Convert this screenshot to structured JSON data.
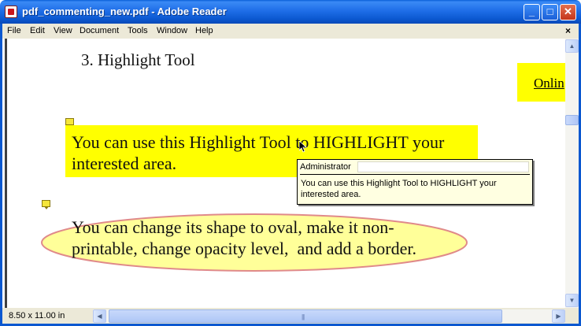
{
  "window": {
    "title": "pdf_commenting_new.pdf - Adobe Reader",
    "buttons": {
      "minimize": "_",
      "maximize": "□",
      "close": "✕"
    }
  },
  "menu": {
    "items": [
      "File",
      "Edit",
      "View",
      "Document",
      "Tools",
      "Window",
      "Help"
    ],
    "close": "×"
  },
  "document": {
    "heading": "3. Highlight Tool",
    "online_text": "Onlin",
    "highlight_paragraph": "You can use this Highlight Tool to HIGHLIGHT your interested area.",
    "oval_paragraph": "You can change its shape to oval, make it non-\nprintable, change opacity level,  and add a border."
  },
  "comment_popup": {
    "author": "Administrator",
    "text": "You can use this Highlight Tool to HIGHLIGHT your interested area."
  },
  "status": {
    "page_size": "8.50 x 11.00 in"
  },
  "colors": {
    "highlight": "#ffff00",
    "oval_fill": "#ffff99",
    "oval_border": "#e08a8a",
    "title_bar": "#0b58d0"
  },
  "icons": {
    "note": "note-icon",
    "cursor": "arrow-cursor-icon",
    "scroll_up": "scroll-up-arrow-icon",
    "scroll_down": "scroll-down-arrow-icon",
    "scroll_left": "scroll-left-arrow-icon",
    "scroll_right": "scroll-right-arrow-icon"
  }
}
